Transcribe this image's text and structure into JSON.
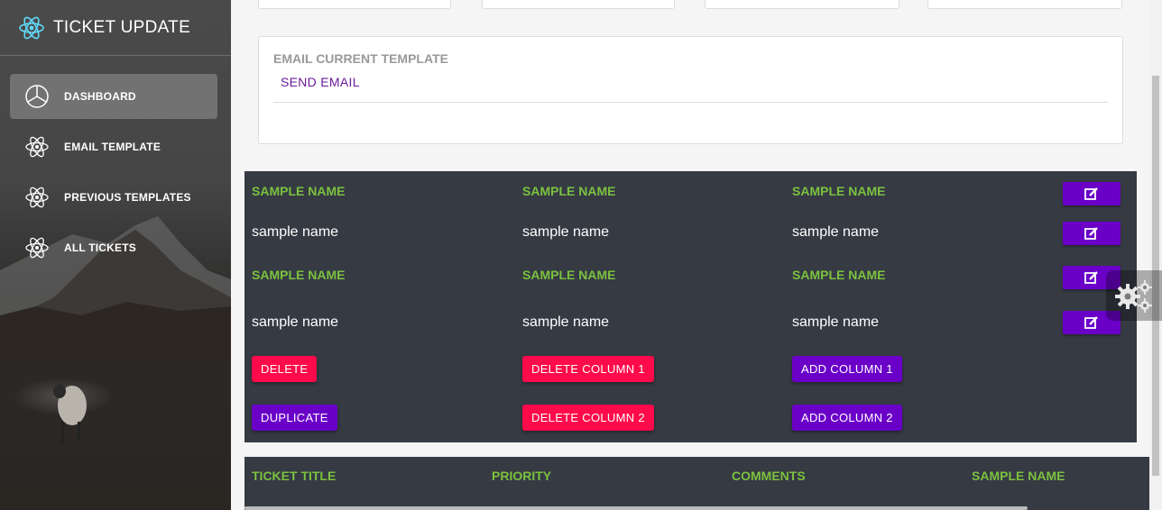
{
  "app": {
    "title": "TICKET UPDATE"
  },
  "sidebar": {
    "items": [
      {
        "label": "DASHBOARD",
        "icon": "pie-chart-icon",
        "active": true
      },
      {
        "label": "EMAIL TEMPLATE",
        "icon": "atom-icon"
      },
      {
        "label": "PREVIOUS TEMPLATES",
        "icon": "atom-icon"
      },
      {
        "label": "ALL TICKETS",
        "icon": "atom-icon"
      }
    ]
  },
  "email_card": {
    "title": "EMAIL CURRENT TEMPLATE",
    "send_link": "SEND EMAIL"
  },
  "template_grid": {
    "rows": [
      [
        "SAMPLE NAME",
        "SAMPLE NAME",
        "SAMPLE NAME"
      ],
      [
        "sample name",
        "sample name",
        "sample name"
      ],
      [
        "SAMPLE NAME",
        "SAMPLE NAME",
        "SAMPLE NAME"
      ],
      [
        "sample name",
        "sample name",
        "sample name"
      ]
    ],
    "buttons": {
      "delete": "DELETE",
      "duplicate": "DUPLICATE",
      "delete_column_1": "DELETE COLUMN 1",
      "delete_column_2": "DELETE COLUMN 2",
      "add_column_1": "ADD COLUMN 1",
      "add_column_2": "ADD COLUMN 2"
    }
  },
  "tickets_table": {
    "headers": [
      "TICKET TITLE",
      "PRIORITY",
      "COMMENTS",
      "SAMPLE NAME"
    ]
  },
  "colors": {
    "accent_green": "#7cc13f",
    "purple": "#6a00c8",
    "red": "#ff0a4a",
    "panel": "#353a43"
  }
}
